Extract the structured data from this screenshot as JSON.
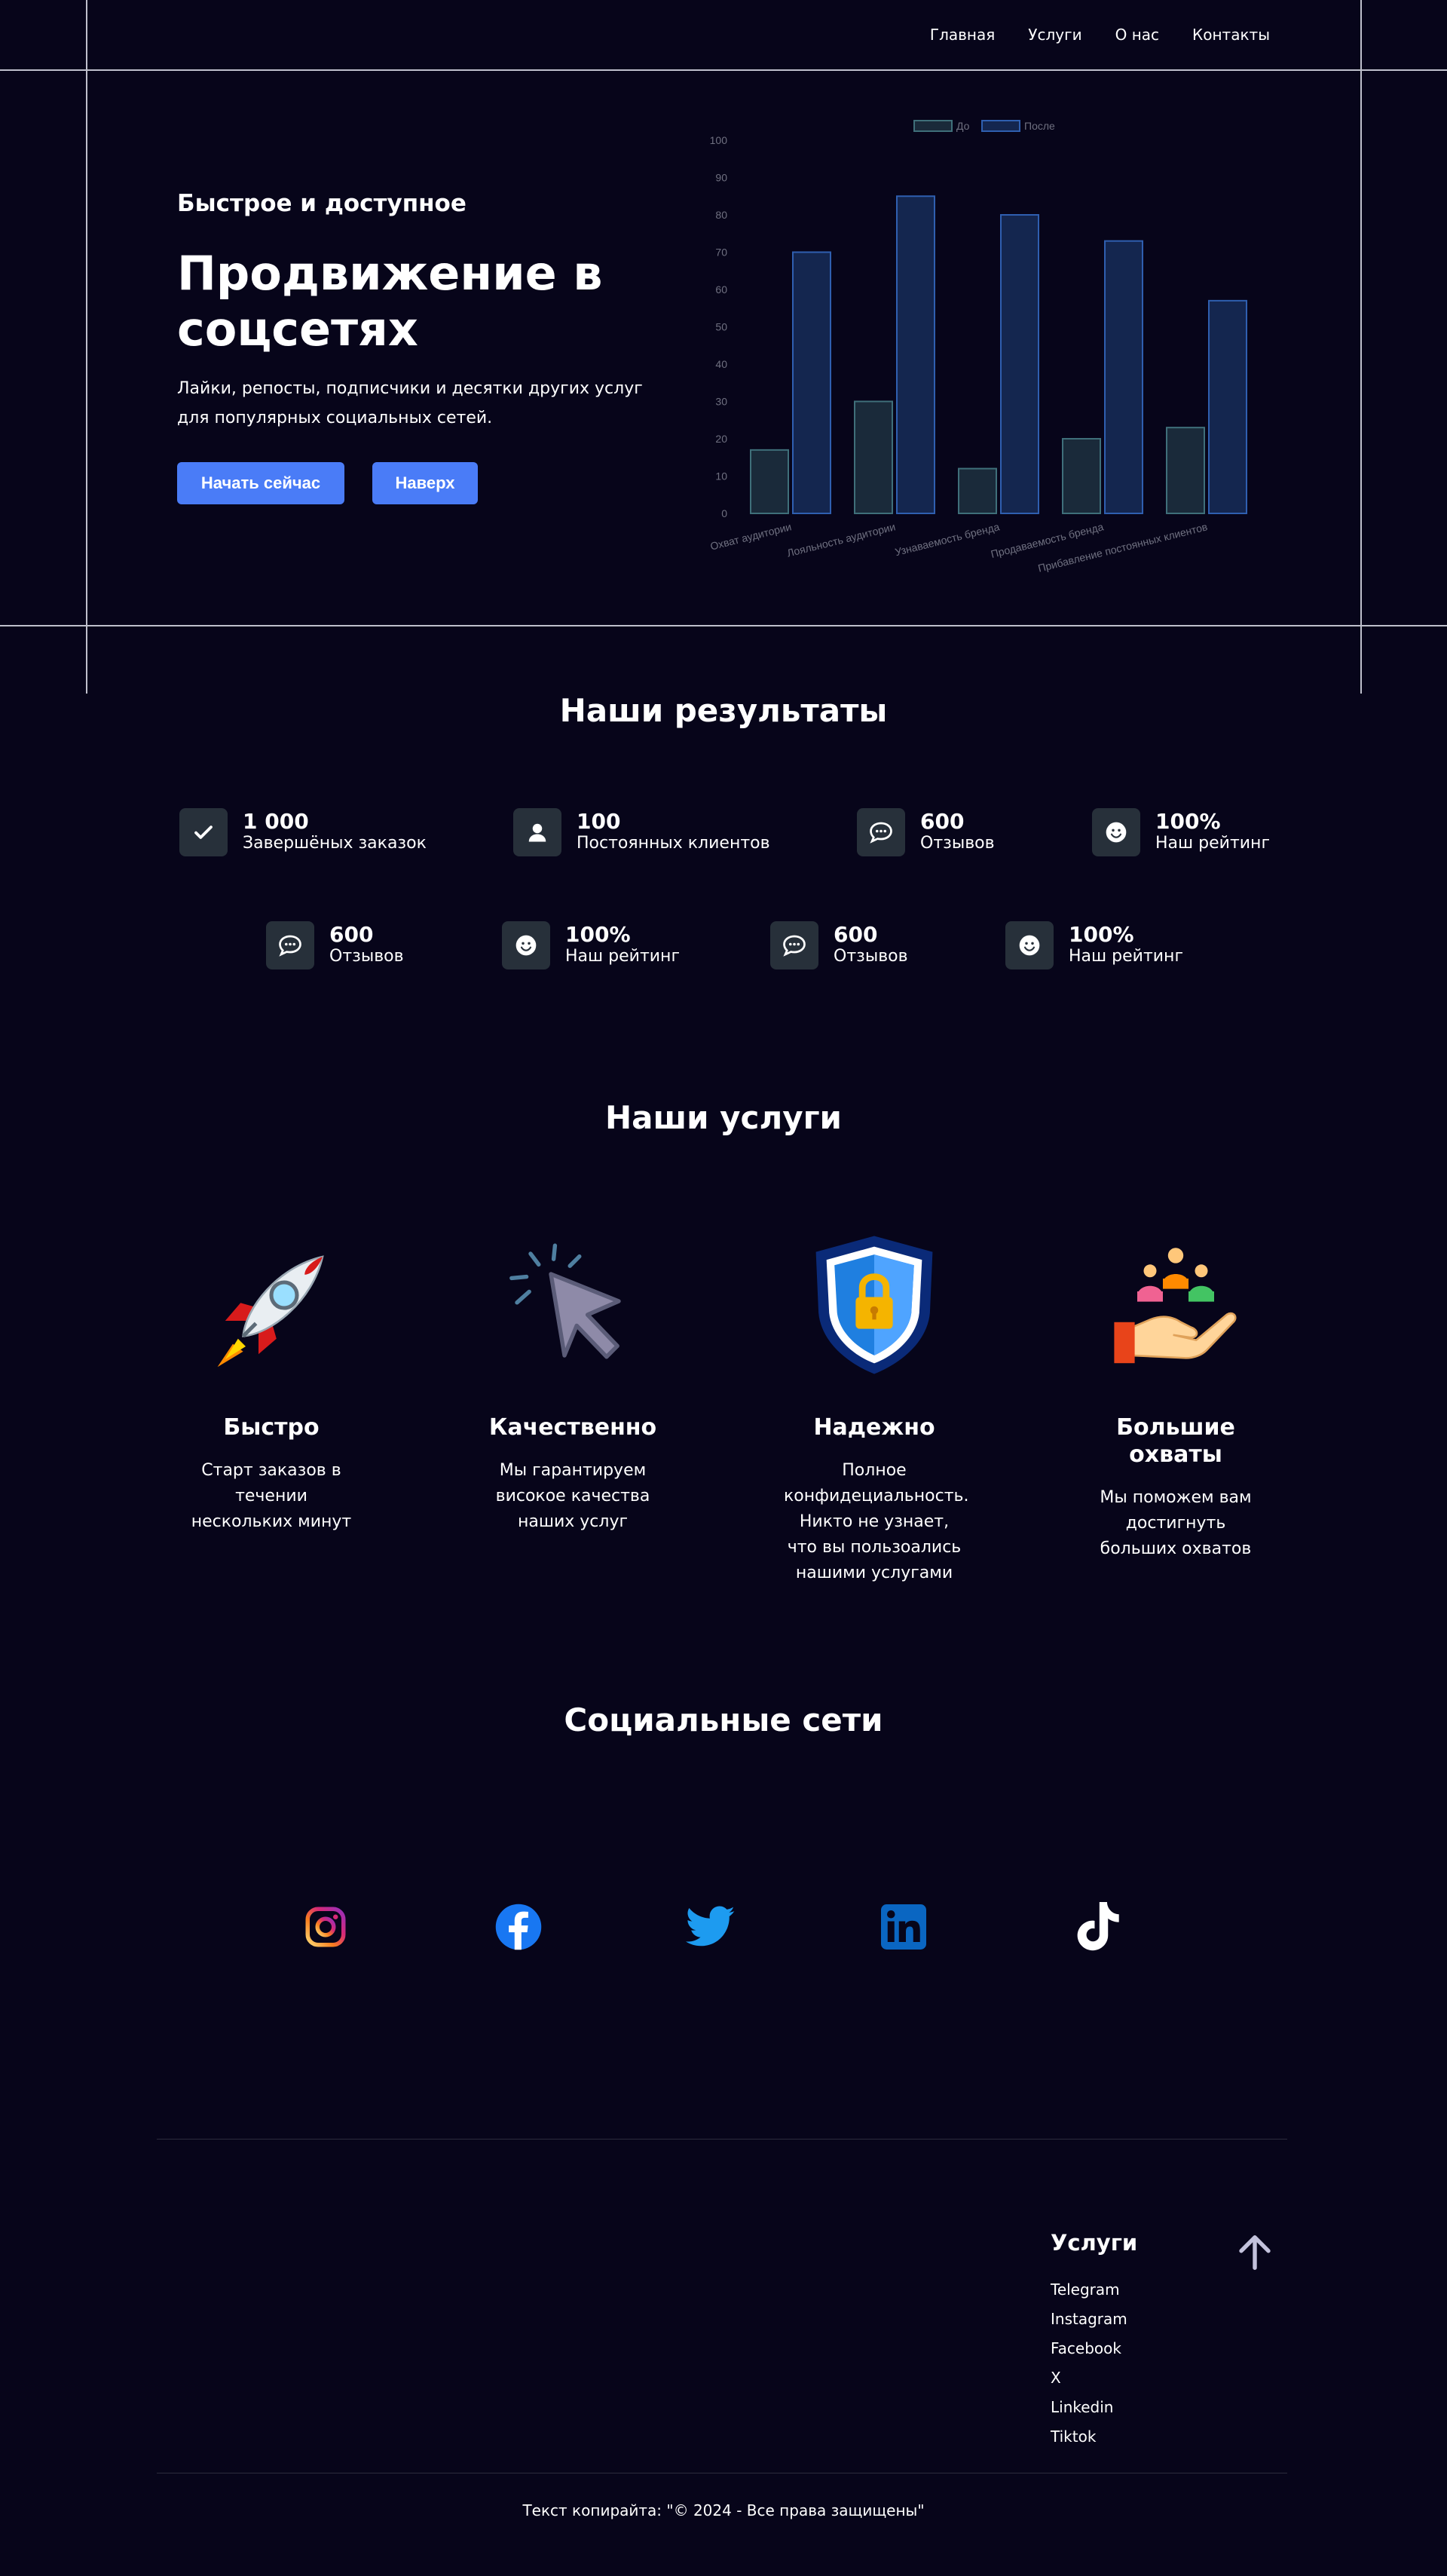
{
  "nav": {
    "items": [
      "Главная",
      "Услуги",
      "О нас",
      "Контакты"
    ]
  },
  "hero": {
    "subtitle": "Быстрое и доступное",
    "title": "Продвижение в соцсетях",
    "description": "Лайки, репосты, подписчики и десятки других услуг для популярных социальных сетей.",
    "start_button": "Начать сейчас",
    "top_button": "Наверх"
  },
  "chart_data": {
    "type": "bar",
    "categories": [
      "Охват аудитории",
      "Лояльность аудитории",
      "Узнаваемость бренда",
      "Продаваемость бренда",
      "Прибавление постоянных клиентов"
    ],
    "series": [
      {
        "name": "До",
        "values": [
          17,
          30,
          12,
          20,
          23
        ]
      },
      {
        "name": "После",
        "values": [
          70,
          85,
          80,
          73,
          57
        ]
      }
    ],
    "ylim": [
      0,
      100
    ],
    "yticks": [
      0,
      10,
      20,
      30,
      40,
      50,
      60,
      70,
      80,
      90,
      100
    ],
    "legend": "top",
    "grid": false,
    "colors": {
      "before_fill": "#1a2a3a",
      "before_stroke": "#3f6f7a",
      "after_fill": "#14264f",
      "after_stroke": "#2f5fb0"
    }
  },
  "results": {
    "title": "Наши результаты",
    "stats": [
      {
        "icon": "check-icon",
        "value": "1 000",
        "label": "Завершёных заказок"
      },
      {
        "icon": "user-icon",
        "value": "100",
        "label": "Постоянных клиентов"
      },
      {
        "icon": "chat-icon",
        "value": "600",
        "label": "Отзывов"
      },
      {
        "icon": "smile-icon",
        "value": "100%",
        "label": "Наш рейтинг"
      },
      {
        "icon": "chat-icon",
        "value": "600",
        "label": "Отзывов"
      },
      {
        "icon": "smile-icon",
        "value": "100%",
        "label": "Наш рейтинг"
      },
      {
        "icon": "chat-icon",
        "value": "600",
        "label": "Отзывов"
      },
      {
        "icon": "smile-icon",
        "value": "100%",
        "label": "Наш рейтинг"
      }
    ]
  },
  "services": {
    "title": "Наши услуги",
    "items": [
      {
        "icon": "rocket-icon",
        "title": "Быстро",
        "text": "Старт заказов в течении нескольких минут"
      },
      {
        "icon": "cursor-icon",
        "title": "Качественно",
        "text": "Мы гарантируем високое качества наших услуг"
      },
      {
        "icon": "shield-lock-icon",
        "title": "Надежно",
        "text": "Полное конфидециальность. Никто не узнает, что вы пользоались нашими услугами"
      },
      {
        "icon": "hand-people-icon",
        "title": "Большие охваты",
        "text": "Мы поможем вам достигнуть больших охватов"
      }
    ]
  },
  "social": {
    "title": "Социальные сети",
    "items": [
      "instagram-icon",
      "facebook-icon",
      "twitter-icon",
      "linkedin-icon",
      "tiktok-icon"
    ]
  },
  "footer": {
    "title": "Услуги",
    "links": [
      "Telegram",
      "Instagram",
      "Facebook",
      "X",
      "Linkedin",
      "Tiktok"
    ],
    "copyright": "Текст копирайта: \"© 2024 - Все права защищены\""
  }
}
